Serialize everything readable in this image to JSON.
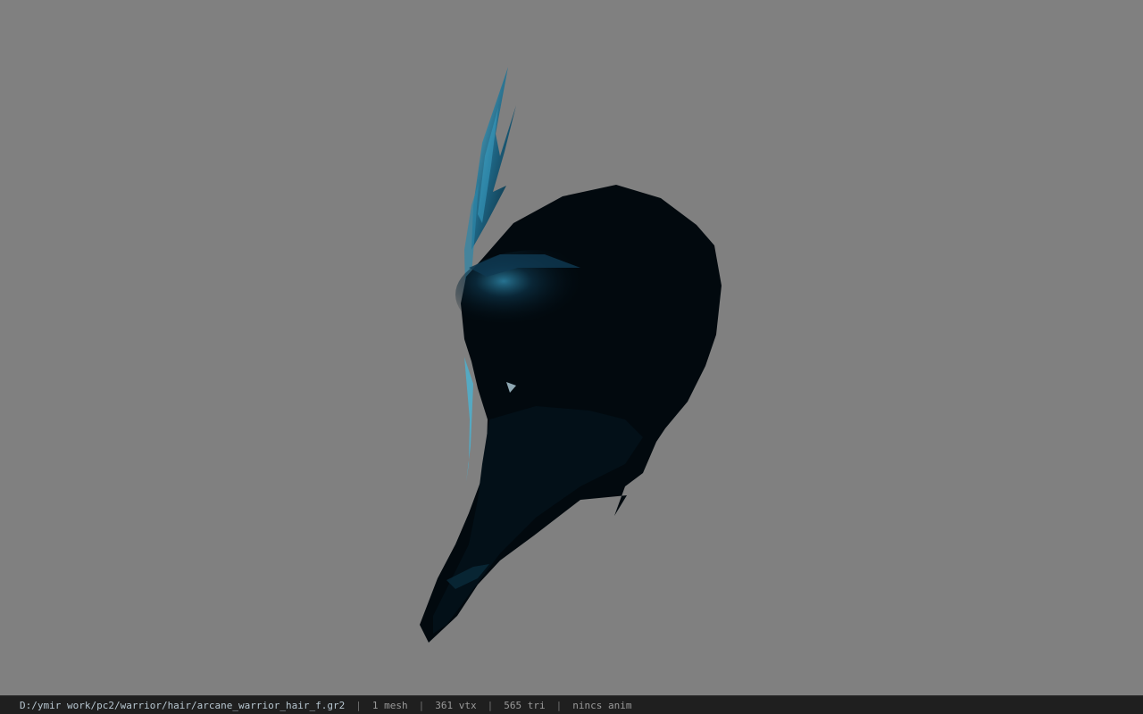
{
  "viewer": {
    "background_color": "#808080",
    "model_name": "arcane_warrior_hair_f",
    "model_primary_color": "#020a10",
    "model_highlight_color": "#3fa8cc"
  },
  "statusbar": {
    "file_path": "D:/ymir work/pc2/warrior/hair/arcane_warrior_hair_f.gr2",
    "separator": "|",
    "mesh_count": "1 mesh",
    "vertex_count": "361 vtx",
    "triangle_count": "565 tri",
    "anim_status": "nincs anim"
  }
}
